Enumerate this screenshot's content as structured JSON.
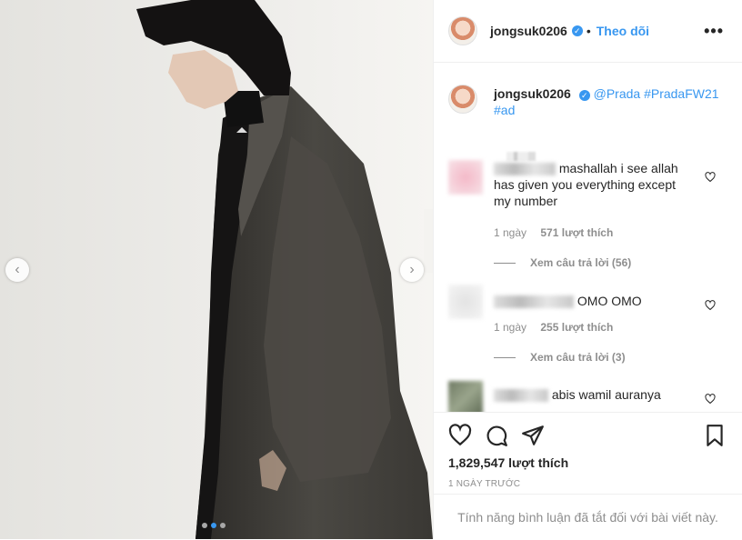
{
  "post": {
    "username": "jongsuk0206",
    "separator": "•",
    "follow_label": "Theo dõi",
    "more_label": "•••"
  },
  "caption": {
    "username": "jongsuk0206",
    "mention": "@Prada",
    "hashtag1": "#PradaFW21",
    "hashtag2": "#ad"
  },
  "comments": [
    {
      "text": "mashallah i see allah has given you everything except my number",
      "time": "1 ngày",
      "likes": "571 lượt thích",
      "replies": "Xem câu trả lời (56)"
    },
    {
      "text": "OMO OMO",
      "time": "1 ngày",
      "likes": "255 lượt thích",
      "replies": "Xem câu trả lời (3)"
    },
    {
      "text": "abis wamil auranya"
    }
  ],
  "stats": {
    "likes": "1,829,547 lượt thích",
    "time_ago": "1 NGÀY TRƯỚC"
  },
  "footer": {
    "comments_disabled": "Tính năng bình luận đã tắt đối với bài viết này."
  },
  "carousel": {
    "prev_icon": "chevron-left-icon",
    "next_icon": "chevron-right-icon",
    "slides": 3,
    "active_slide": 2
  },
  "colors": {
    "accent": "#3897f0",
    "secondary_text": "#8e8e8e",
    "primary_text": "#262626",
    "border": "#efefef"
  }
}
